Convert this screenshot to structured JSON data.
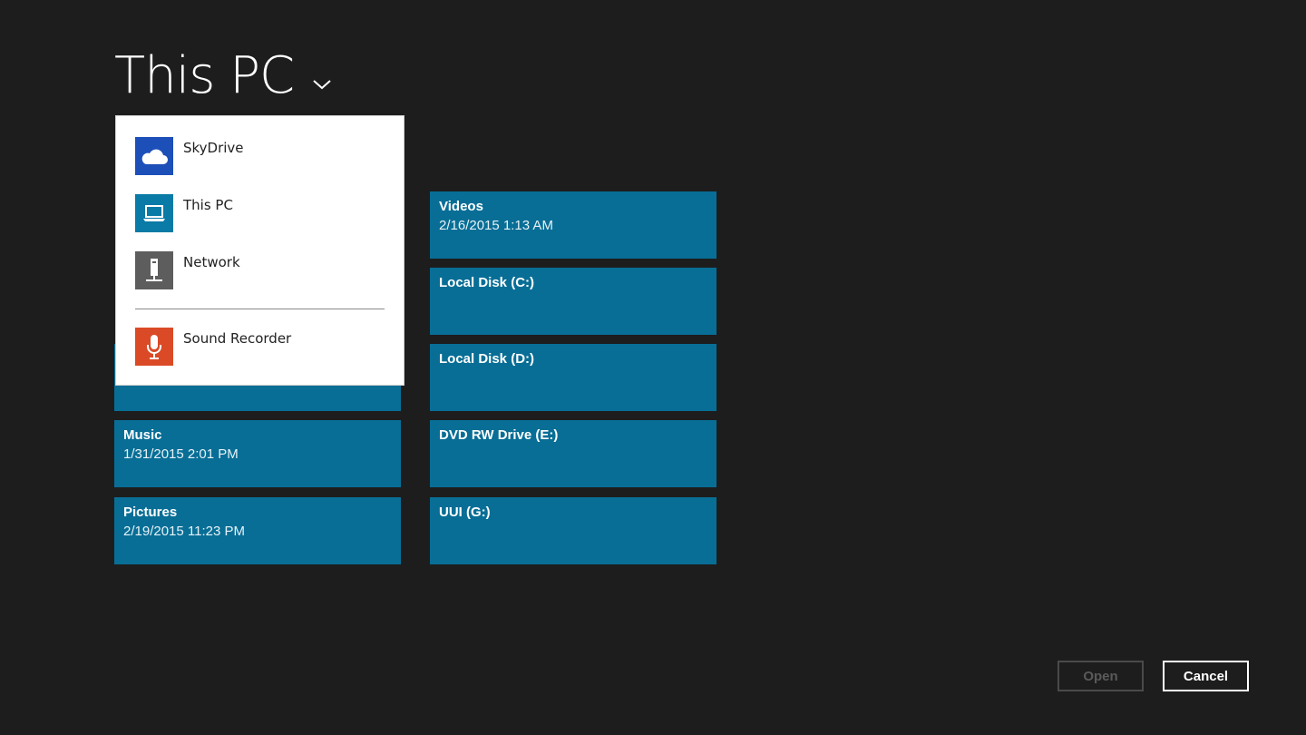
{
  "header": {
    "title": "This PC",
    "chevron_icon": "chevron-down-icon"
  },
  "dropdown": {
    "items": [
      {
        "label": "SkyDrive",
        "icon": "cloud-icon",
        "color": "#1c4fb8"
      },
      {
        "label": "This PC",
        "icon": "laptop-icon",
        "color": "#0a7aa6"
      },
      {
        "label": "Network",
        "icon": "network-icon",
        "color": "#5d5d5d"
      },
      {
        "label": "Sound Recorder",
        "icon": "microphone-icon",
        "color": "#db4a26"
      }
    ]
  },
  "folders": [
    {
      "name": "",
      "date": ""
    },
    {
      "name": "Music",
      "date": "1/31/2015 2:01 PM"
    },
    {
      "name": "Pictures",
      "date": "2/19/2015 11:23 PM"
    }
  ],
  "drives": [
    {
      "name": "Videos",
      "date": "2/16/2015 1:13 AM"
    },
    {
      "name": "Local Disk (C:)",
      "date": ""
    },
    {
      "name": "Local Disk (D:)",
      "date": ""
    },
    {
      "name": "DVD RW Drive (E:)",
      "date": ""
    },
    {
      "name": "UUI (G:)",
      "date": ""
    }
  ],
  "footer": {
    "open_label": "Open",
    "cancel_label": "Cancel"
  },
  "colors": {
    "background": "#1d1d1d",
    "tile": "#086e96"
  }
}
